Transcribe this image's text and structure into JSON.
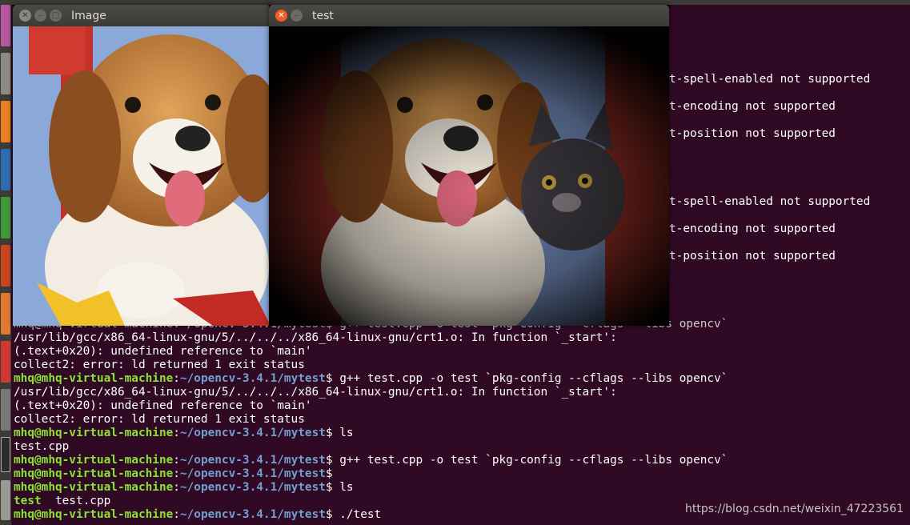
{
  "launcher": {
    "icons": [
      "dash-icon",
      "files-icon",
      "firefox-icon",
      "libreoffice-writer-icon",
      "libreoffice-calc-icon",
      "libreoffice-impress-icon",
      "software-center-icon",
      "amazon-icon",
      "settings-icon",
      "terminal-icon",
      "trash-icon"
    ]
  },
  "image_window": {
    "title": "Image",
    "close_icon": "close-icon",
    "minimize_icon": "minimize-icon",
    "maximize_icon": "maximize-icon"
  },
  "test_window": {
    "title": "test",
    "close_icon": "close-icon",
    "minimize_icon": "minimize-icon"
  },
  "terminal": {
    "prompt_user": "mhq@mhq-virtual-machine",
    "prompt_sep": ":",
    "prompt_path": "~/opencv-3.4.1/mytest",
    "prompt_end": "$ ",
    "right_messages": [
      "t-spell-enabled not supported",
      "t-encoding not supported",
      "t-position not supported",
      "t-spell-enabled not supported",
      "t-encoding not supported",
      "t-position not supported"
    ],
    "partial_first_line": "mhq@mhq-virtual-machine:~/opencv-3.4.1/mytest$ g++ test.cpp -o test `pkg-config --cflags --libs opencv`",
    "lines": [
      {
        "type": "out",
        "text": "/usr/lib/gcc/x86_64-linux-gnu/5/../../../x86_64-linux-gnu/crt1.o: In function `_start':"
      },
      {
        "type": "out",
        "text": "(.text+0x20): undefined reference to `main'"
      },
      {
        "type": "out",
        "text": "collect2: error: ld returned 1 exit status"
      },
      {
        "type": "cmd",
        "text": "g++ test.cpp -o test `pkg-config --cflags --libs opencv`"
      },
      {
        "type": "out",
        "text": "/usr/lib/gcc/x86_64-linux-gnu/5/../../../x86_64-linux-gnu/crt1.o: In function `_start':"
      },
      {
        "type": "out",
        "text": "(.text+0x20): undefined reference to `main'"
      },
      {
        "type": "out",
        "text": "collect2: error: ld returned 1 exit status"
      },
      {
        "type": "cmd",
        "text": "ls"
      },
      {
        "type": "out",
        "text": "test.cpp"
      },
      {
        "type": "cmd",
        "text": "g++ test.cpp -o test `pkg-config --cflags --libs opencv`"
      },
      {
        "type": "cmd",
        "text": ""
      },
      {
        "type": "cmd",
        "text": "ls"
      },
      {
        "type": "ls",
        "text": "test",
        "text2": "  test.cpp"
      },
      {
        "type": "cmd",
        "text": "./test"
      }
    ]
  },
  "watermark": "https://blog.csdn.net/weixin_47223561"
}
